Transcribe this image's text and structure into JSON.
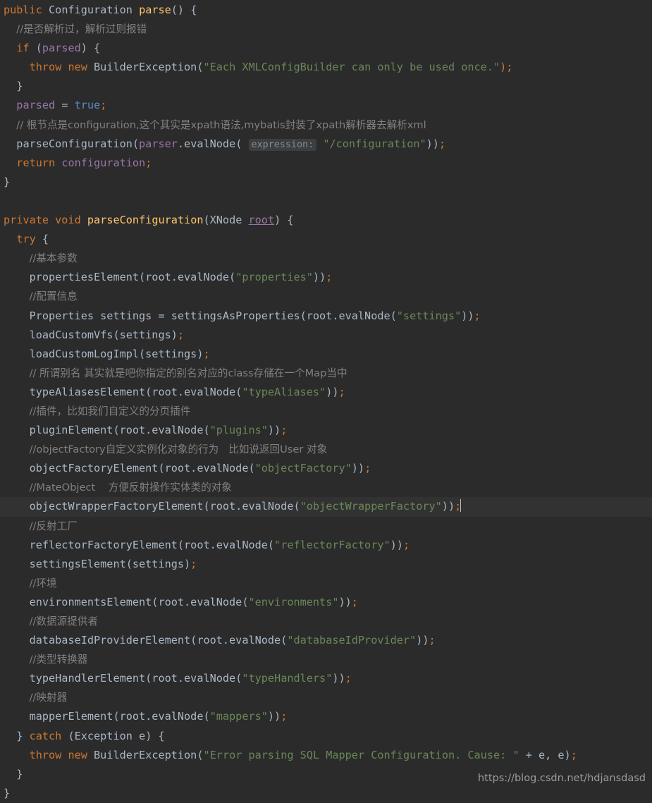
{
  "editor": {
    "theme": "darcula",
    "background": "#2b2b2b",
    "current_line_background": "#323232",
    "foreground": "#a9b7c6",
    "language": "Java",
    "current_line_index": 25,
    "caret_visible": true,
    "colors": {
      "keyword": "#cc7832",
      "string": "#6a8759",
      "comment": "#808080",
      "field": "#9876aa",
      "method_declaration": "#ffc66d",
      "parameter_hint_text": "#8a8a8a",
      "parameter_hint_background": "#3c3f41",
      "caret": "#bbbbbb",
      "watermark": "#9b9b9b"
    }
  },
  "watermark": {
    "text": "https://blog.csdn.net/hdjansdasd"
  },
  "parameter_hint": {
    "label": "expression:"
  },
  "code": {
    "l1": "public Configuration parse() {",
    "l2": "//是否解析过，解析过则报错",
    "l3": "if (parsed) {",
    "l4_a": "throw new BuilderException(",
    "l4_str": "\"Each XMLConfigBuilder can only be used once.\"",
    "l4_b": ");",
    "l5": "}",
    "l6_a": "parsed = ",
    "l6_b": "true",
    "l6_c": ";",
    "l7": "// 根节点是configuration,这个其实是xpath语法,mybatis封装了xpath解析器去解析xml",
    "l8_a": "parseConfiguration(parser.evalNode(",
    "l8_str": "\"/configuration\"",
    "l8_b": "));",
    "l9_a": "return ",
    "l9_b": "configuration",
    "l9_c": ";",
    "l10": "}",
    "l11": "",
    "l12_kw": "private void ",
    "l12_meth": "parseConfiguration",
    "l12_open": "(",
    "l12_type": "XNode ",
    "l12_param": "root",
    "l12_close": ") {",
    "l13": "try {",
    "l14": "//基本参数",
    "l15_a": "propertiesElement(root.evalNode(",
    "l15_str": "\"properties\"",
    "l15_b": "));",
    "l16": "//配置信息",
    "l17_a": "Properties settings = settingsAsProperties(root.evalNode(",
    "l17_str": "\"settings\"",
    "l17_b": "));",
    "l18": "loadCustomVfs(settings);",
    "l19": "loadCustomLogImpl(settings);",
    "l20": "// 所谓别名 其实就是吧你指定的别名对应的class存储在一个Map当中",
    "l21_a": "typeAliasesElement(root.evalNode(",
    "l21_str": "\"typeAliases\"",
    "l21_b": "));",
    "l22": "//插件，比如我们自定义的分页插件",
    "l23_a": "pluginElement(root.evalNode(",
    "l23_str": "\"plugins\"",
    "l23_b": "));",
    "l24": "//objectFactory自定义实例化对象的行为   比如说返回User 对象",
    "l25_a": "objectFactoryElement(root.evalNode(",
    "l25_str": "\"objectFactory\"",
    "l25_b": "));",
    "l26": "//MateObject    方便反射操作实体类的对象",
    "l27_a": "objectWrapperFactoryElement(root.evalNode(",
    "l27_str": "\"objectWrapperFactory\"",
    "l27_b": "));",
    "l28": "//反射工厂",
    "l29_a": "reflectorFactoryElement(root.evalNode(",
    "l29_str": "\"reflectorFactory\"",
    "l29_b": "));",
    "l30": "settingsElement(settings);",
    "l31": "//环境",
    "l32_a": "environmentsElement(root.evalNode(",
    "l32_str": "\"environments\"",
    "l32_b": "));",
    "l33": "//数据源提供者",
    "l34_a": "databaseIdProviderElement(root.evalNode(",
    "l34_str": "\"databaseIdProvider\"",
    "l34_b": "));",
    "l35": "//类型转换器",
    "l36_a": "typeHandlerElement(root.evalNode(",
    "l36_str": "\"typeHandlers\"",
    "l36_b": "));",
    "l37": "//映射器",
    "l38_a": "mapperElement(root.evalNode(",
    "l38_str": "\"mappers\"",
    "l38_b": "));",
    "l39_a": "} ",
    "l39_b": "catch",
    "l39_c": " (Exception e) {",
    "l40_a": "throw new BuilderException(",
    "l40_str": "\"Error parsing SQL Mapper Configuration. Cause: \"",
    "l40_b": " + e, e);",
    "l41": "}",
    "l42": "}"
  }
}
